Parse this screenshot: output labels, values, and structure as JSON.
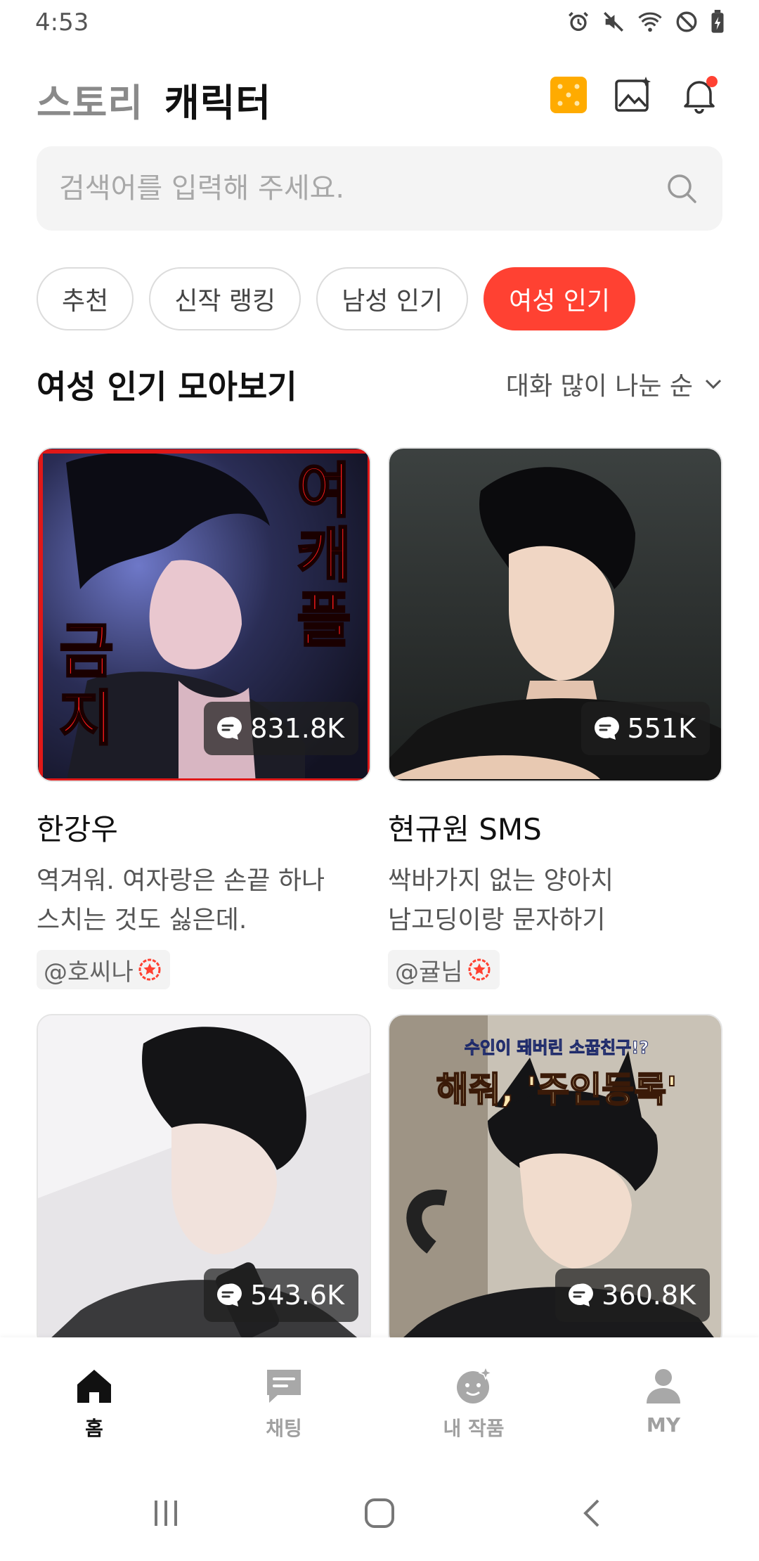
{
  "status_bar": {
    "time": "4:53",
    "icons": [
      "alarm-icon",
      "mute-icon",
      "wifi-icon",
      "do-not-disturb-icon",
      "battery-charging-icon"
    ]
  },
  "header": {
    "tabs": [
      {
        "label": "스토리",
        "active": false
      },
      {
        "label": "캐릭터",
        "active": true
      }
    ],
    "actions": [
      "dice-icon",
      "image-create-icon",
      "bell-icon"
    ],
    "notification_dot_color": "#ff4132",
    "dice_color": "#ffab00"
  },
  "search": {
    "placeholder": "검색어를 입력해 주세요.",
    "value": ""
  },
  "filter_chips": [
    {
      "label": "추천",
      "active": false
    },
    {
      "label": "신작 랭킹",
      "active": false
    },
    {
      "label": "남성 인기",
      "active": false
    },
    {
      "label": "여성 인기",
      "active": true
    }
  ],
  "section": {
    "title": "여성 인기 모아보기",
    "sort_label": "대화 많이 나눈 순"
  },
  "cards": [
    {
      "name": "한강우",
      "desc_line1": "역겨워. 여자랑은 손끝 하나",
      "desc_line2": "스치는 것도 싫은데.",
      "author": "@호씨나",
      "chat_count": "831.8K",
      "overlay_text_1": "여캐플",
      "overlay_text_2": "금지"
    },
    {
      "name": "현규원 SMS",
      "desc_line1": "싹바가지 없는 양아치",
      "desc_line2": "남고딩이랑 문자하기",
      "author": "@귤님",
      "chat_count": "551K"
    },
    {
      "name": "",
      "chat_count": "543.6K"
    },
    {
      "name": "",
      "chat_count": "360.8K",
      "overlay_small": "수인이 돼버린 소꿉친구!?",
      "overlay_big": "해줘, '주인등록'"
    }
  ],
  "bottom_nav": [
    {
      "label": "홈",
      "icon": "home-icon",
      "active": true
    },
    {
      "label": "채팅",
      "icon": "chat-icon",
      "active": false
    },
    {
      "label": "내 작품",
      "icon": "my-works-icon",
      "active": false
    },
    {
      "label": "MY",
      "icon": "profile-icon",
      "active": false
    }
  ],
  "accent_color": "#ff4132"
}
